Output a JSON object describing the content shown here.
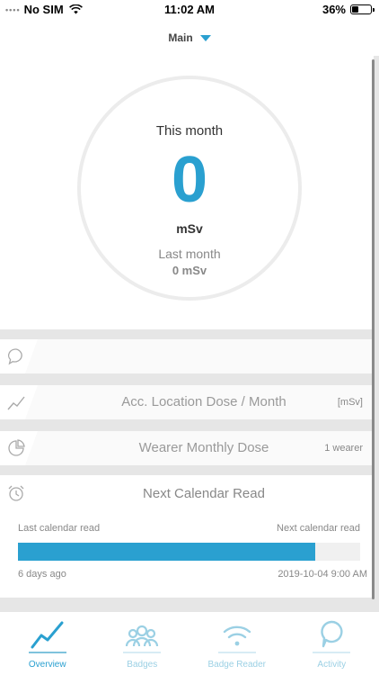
{
  "status_bar": {
    "signal": "••••",
    "carrier": "No SIM",
    "time": "11:02 AM",
    "battery": "36%",
    "wifi_icon": "wifi-icon"
  },
  "header": {
    "title": "Main",
    "dropdown_icon": "caret-down-icon"
  },
  "dose_gauge": {
    "label": "This month",
    "value": "0",
    "unit": "mSv",
    "last_label": "Last month",
    "last_value": "0 mSv"
  },
  "cards": [
    {
      "id": "activity",
      "icon": "speech-bubble-icon",
      "title": "",
      "meta": ""
    },
    {
      "id": "location-dose",
      "icon": "line-chart-icon",
      "title": "Acc. Location Dose / Month",
      "meta": "[mSv]"
    },
    {
      "id": "wearer-dose",
      "icon": "pie-chart-icon",
      "title": "Wearer Monthly Dose",
      "meta": "1 wearer"
    }
  ],
  "calendar": {
    "icon": "alarm-clock-icon",
    "title": "Next Calendar Read",
    "last_label": "Last calendar read",
    "next_label": "Next calendar read",
    "last_value": "6 days ago",
    "next_value": "2019-10-04 9:00 AM",
    "progress": 0.87,
    "accent": "#2aa0d0"
  },
  "tabs": [
    {
      "label": "Overview",
      "icon": "overview-chart-icon",
      "active": true
    },
    {
      "label": "Badges",
      "icon": "badges-people-icon",
      "active": false
    },
    {
      "label": "Badge Reader",
      "icon": "reader-signal-icon",
      "active": false
    },
    {
      "label": "Activity",
      "icon": "activity-bubble-icon",
      "active": false
    }
  ],
  "colors": {
    "accent": "#2aa0d0",
    "background": "#e6e6e6"
  }
}
